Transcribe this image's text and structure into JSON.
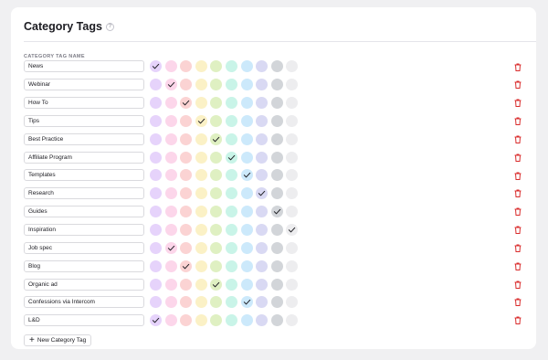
{
  "header": {
    "title": "Category Tags",
    "help_icon": "question-circle-icon"
  },
  "column_label": "CATEGORY TAG NAME",
  "colors": [
    "#e6d3fb",
    "#fcd6ea",
    "#fbd3d3",
    "#fbf1c6",
    "#dff0c2",
    "#c9f4e8",
    "#cce9fb",
    "#d9d9f3",
    "#d2d5d9",
    "#ededef"
  ],
  "check_color": "#1f1f24",
  "delete_color": "#d92b2b",
  "tags": [
    {
      "name": "News",
      "selected": 0
    },
    {
      "name": "Webinar",
      "selected": 1
    },
    {
      "name": "How To",
      "selected": 2
    },
    {
      "name": "Tips",
      "selected": 3
    },
    {
      "name": "Best Practice",
      "selected": 4
    },
    {
      "name": "Affiliate Program",
      "selected": 5
    },
    {
      "name": "Templates",
      "selected": 6
    },
    {
      "name": "Research",
      "selected": 7
    },
    {
      "name": "Guides",
      "selected": 8
    },
    {
      "name": "Inspiration",
      "selected": 9
    },
    {
      "name": "Job spec",
      "selected": 1
    },
    {
      "name": "Blog",
      "selected": 2
    },
    {
      "name": "Organic ad",
      "selected": 4
    },
    {
      "name": "Confessions via Intercom",
      "selected": 6
    },
    {
      "name": "L&D",
      "selected": 0
    }
  ],
  "add_button_label": "New Category Tag"
}
